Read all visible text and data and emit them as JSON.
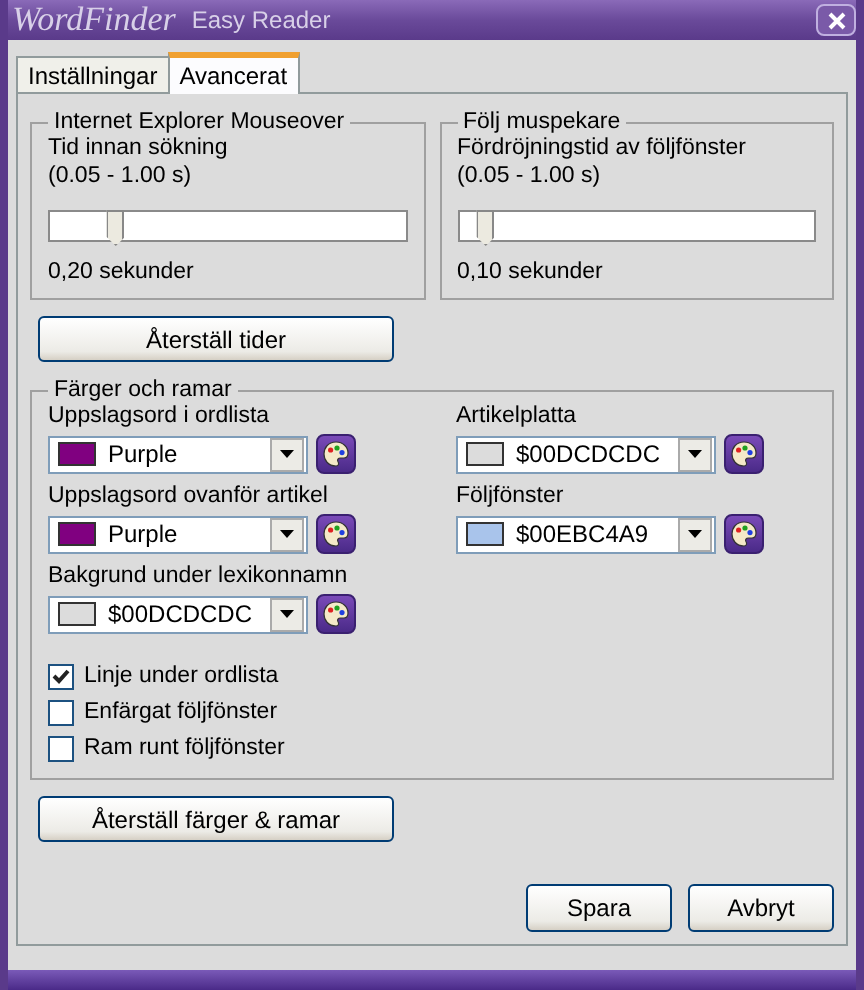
{
  "window": {
    "logo": "WordFinder",
    "title": "Easy Reader"
  },
  "tabs": [
    {
      "label": "Inställningar",
      "selected": false
    },
    {
      "label": "Avancerat",
      "selected": true
    }
  ],
  "timing_groups": [
    {
      "title": "Internet Explorer Mouseover",
      "label": "Tid innan sökning",
      "range": "(0.05 - 1.00 s)",
      "level": 0.16,
      "reading": "0,20 sekunder"
    },
    {
      "title": "Följ muspekare",
      "label": "Fördröjningstid av följfönster",
      "range": "(0.05 - 1.00 s)",
      "level": 0.05,
      "reading": "0,10 sekunder"
    }
  ],
  "reset_times_button": "Återställ tider",
  "colors_group": {
    "title": "Färger och ramar",
    "left_column": [
      {
        "label": "Uppslagsord i ordlista",
        "value": "Purple",
        "color": "#800080"
      },
      {
        "label": "Uppslagsord ovanför artikel",
        "value": "Purple",
        "color": "#800080"
      },
      {
        "label": "Bakgrund under lexikonnamn",
        "value": "$00DCDCDC",
        "color": "#dcdcdc"
      }
    ],
    "right_column": [
      {
        "label": "Artikelplatta",
        "value": "$00DCDCDC",
        "color": "#dcdcdc"
      },
      {
        "label": "Följfönster",
        "value": "$00EBC4A9",
        "color": "#a9c4eb"
      }
    ],
    "checkboxes": [
      {
        "label": "Linje under ordlista",
        "checked": true
      },
      {
        "label": "Enfärgat följfönster",
        "checked": false
      },
      {
        "label": "Ram runt följfönster",
        "checked": false
      }
    ]
  },
  "reset_colors_button": "Återställ färger & ramar",
  "buttons": [
    "Spara",
    "Avbryt"
  ]
}
